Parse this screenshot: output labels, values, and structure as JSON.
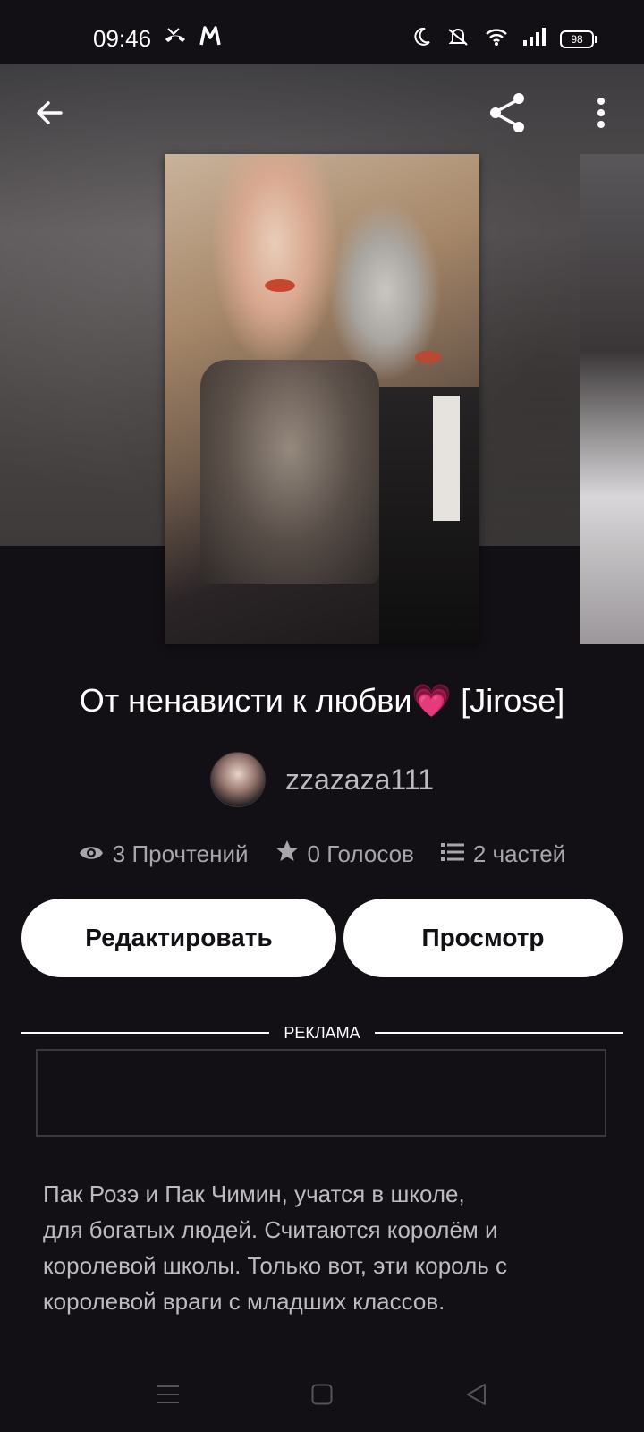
{
  "status_bar": {
    "time": "09:46",
    "battery": "98",
    "icons": [
      "missed-call-icon",
      "m-app-icon",
      "moon-icon",
      "mute-icon",
      "wifi-icon",
      "signal-icon",
      "battery-icon"
    ]
  },
  "toolbar": {
    "back_icon": "arrow-left-icon",
    "share_icon": "share-icon",
    "more_icon": "more-vertical-icon"
  },
  "story": {
    "title": "От ненависти к любви💗 [Jirose]",
    "author": "zzazaza111",
    "reads": "3 Прочтений",
    "votes": "0 Голосов",
    "parts": "2 частей",
    "description_lines": [
      "Пак Розэ и Пак Чимин, учатся в школе,",
      "для богатых людей. Считаются королём и",
      "королевой школы. Только вот, эти король с",
      "королевой враги с младших классов."
    ]
  },
  "actions": {
    "edit_label": "Редактировать",
    "view_label": "Просмотр"
  },
  "ad": {
    "label": "РЕКЛАМА"
  },
  "colors": {
    "background": "#121015",
    "button_bg": "#ffffff",
    "muted_text": "#a8a6aa"
  }
}
